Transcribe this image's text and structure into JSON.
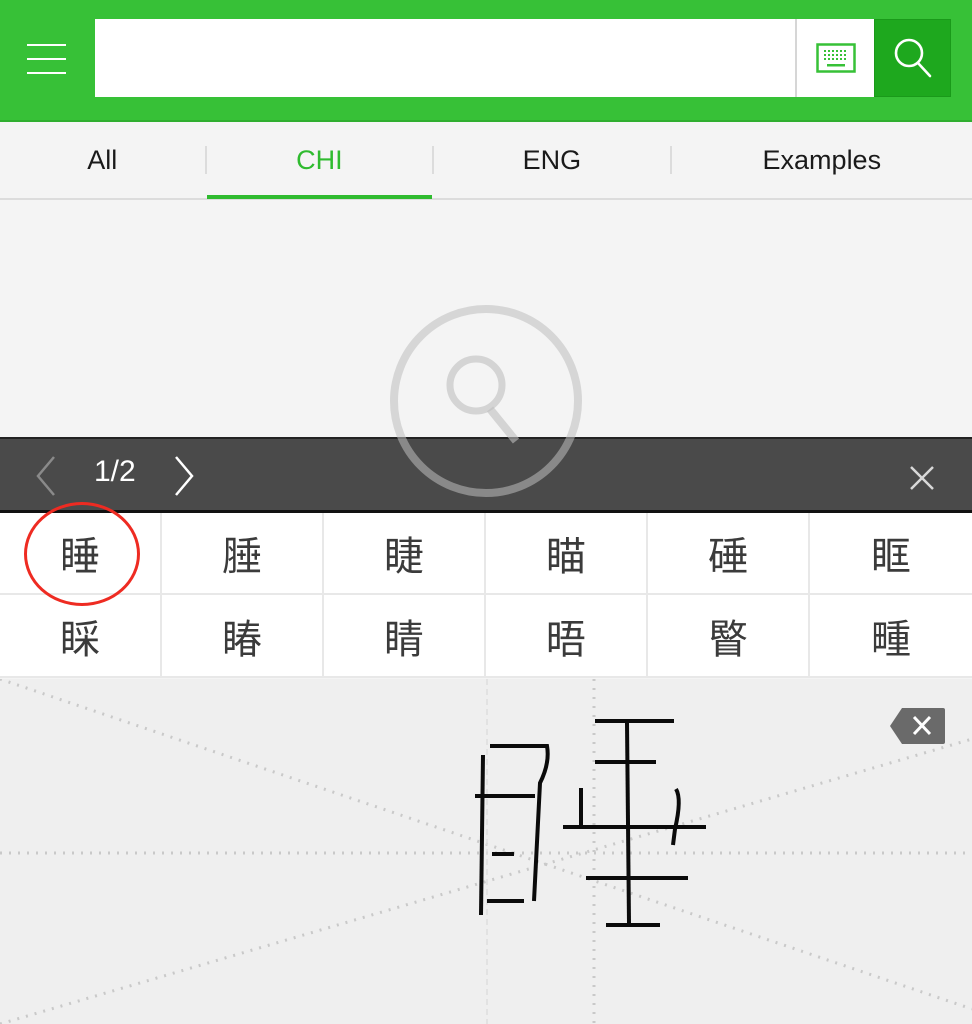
{
  "header": {
    "menu_icon": "hamburger-menu-icon",
    "search_value": "",
    "search_placeholder": "",
    "keyboard_icon": "keyboard-icon",
    "search_icon": "search-icon",
    "colors": {
      "brand": "#37c137",
      "search_button": "#1ea81e"
    }
  },
  "tabs": [
    {
      "label": "All",
      "active": false
    },
    {
      "label": "CHI",
      "active": true
    },
    {
      "label": "ENG",
      "active": false
    },
    {
      "label": "Examples",
      "active": false
    }
  ],
  "empty_state": {
    "icon": "search-placeholder-icon"
  },
  "candidates": {
    "page_indicator": "1/2",
    "prev_icon": "chevron-left-icon",
    "next_icon": "chevron-right-icon",
    "close_icon": "close-icon",
    "items": [
      "睡",
      "腄",
      "睫",
      "瞄",
      "硾",
      "眶",
      "睬",
      "睶",
      "睛",
      "晤",
      "睯",
      "畽"
    ],
    "highlighted_index": 0,
    "highlight_color": "#ee2b22"
  },
  "handwriting_pad": {
    "backspace_icon": "backspace-icon",
    "drawn_character_hint": "睡"
  }
}
